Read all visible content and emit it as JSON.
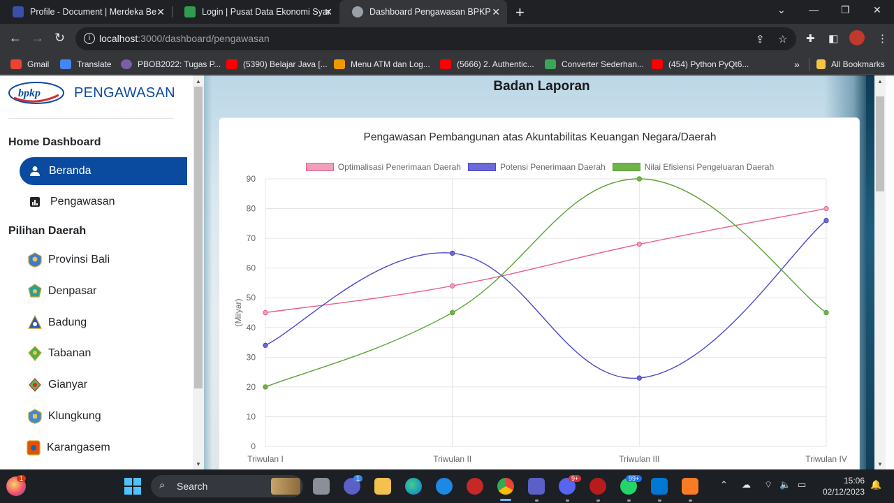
{
  "browser": {
    "tabs": [
      {
        "title": "Profile - Document | Merdeka Be",
        "favicon_color": "#3b4ea8"
      },
      {
        "title": "Login | Pusat Data Ekonomi Syar",
        "favicon_color": "#2e9d4f"
      },
      {
        "title": "Dashboard Pengawasan BPKP",
        "favicon_color": "#9aa0a6"
      }
    ],
    "url": {
      "host": "localhost",
      "path": ":3000/dashboard/pengawasan"
    },
    "bookmarks": [
      {
        "label": "Gmail",
        "icon": "gmail-icon",
        "color": "#ea4335"
      },
      {
        "label": "Translate",
        "icon": "translate-icon",
        "color": "#4285f4"
      },
      {
        "label": "PBOB2022: Tugas P...",
        "icon": "pbob-icon",
        "color": "#7b5ea7"
      },
      {
        "label": "(5390) Belajar Java [...",
        "icon": "youtube-icon",
        "color": "#ff0000"
      },
      {
        "label": "Menu ATM dan Log...",
        "icon": "box-icon",
        "color": "#f29900"
      },
      {
        "label": "(5666) 2. Authentic...",
        "icon": "youtube-icon",
        "color": "#ff0000"
      },
      {
        "label": "Converter Sederhan...",
        "icon": "cup-icon",
        "color": "#3aa757"
      },
      {
        "label": "(454) Python PyQt6...",
        "icon": "youtube-icon",
        "color": "#ff0000"
      }
    ],
    "all_bookmarks": "All Bookmarks",
    "more_bookmarks": "»"
  },
  "sidebar": {
    "logo_text": "bpkp",
    "brand": "PENGAWASAN",
    "section_home": "Home Dashboard",
    "nav": [
      {
        "label": "Beranda",
        "icon": "user-icon",
        "active": true
      },
      {
        "label": "Pengawasan",
        "icon": "bar-chart-icon",
        "active": false
      }
    ],
    "section_regions": "Pilihan Daerah",
    "regions": [
      {
        "label": "Provinsi Bali",
        "color": "#3a7bd5"
      },
      {
        "label": "Denpasar",
        "color": "#2aa198"
      },
      {
        "label": "Badung",
        "color": "#2757b8"
      },
      {
        "label": "Tabanan",
        "color": "#4caf50"
      },
      {
        "label": "Gianyar",
        "color": "#6ab04c"
      },
      {
        "label": "Klungkung",
        "color": "#3d8bd8"
      },
      {
        "label": "Karangasem",
        "color": "#e65100"
      }
    ]
  },
  "main": {
    "report_title": "Badan Laporan"
  },
  "chart_data": {
    "type": "line",
    "title": "Pengawasan Pembangunan atas Akuntabilitas Keuangan Negara/Daerah",
    "categories": [
      "Triwulan I",
      "Triwulan II",
      "Triwulan III",
      "Triwulan IV"
    ],
    "ylabel": "(Milyar)",
    "xlabel": "",
    "ylim": [
      0,
      90
    ],
    "yticks": [
      0,
      10,
      20,
      30,
      40,
      50,
      60,
      70,
      80,
      90
    ],
    "grid": true,
    "legend_position": "top",
    "series": [
      {
        "name": "Optimalisasi Penerimaan Daerah",
        "values": [
          45,
          54,
          68,
          80
        ],
        "color": "#e8608c",
        "fill": "#f0a0ba"
      },
      {
        "name": "Potensi Penerimaan Daerah",
        "values": [
          34,
          65,
          23,
          76
        ],
        "color": "#4a48c8",
        "fill": "#6b6ad8"
      },
      {
        "name": "Nilai Efisiensi Pengeluaran Daerah",
        "values": [
          20,
          45,
          90,
          45
        ],
        "color": "#5aa334",
        "fill": "#6fb44a"
      }
    ]
  },
  "taskbar": {
    "search_label": "Search",
    "time": "15:06",
    "date": "02/12/2023",
    "badges": {
      "teams": "1",
      "discord": "9+",
      "whatsapp": "99+",
      "widget": "1"
    }
  }
}
